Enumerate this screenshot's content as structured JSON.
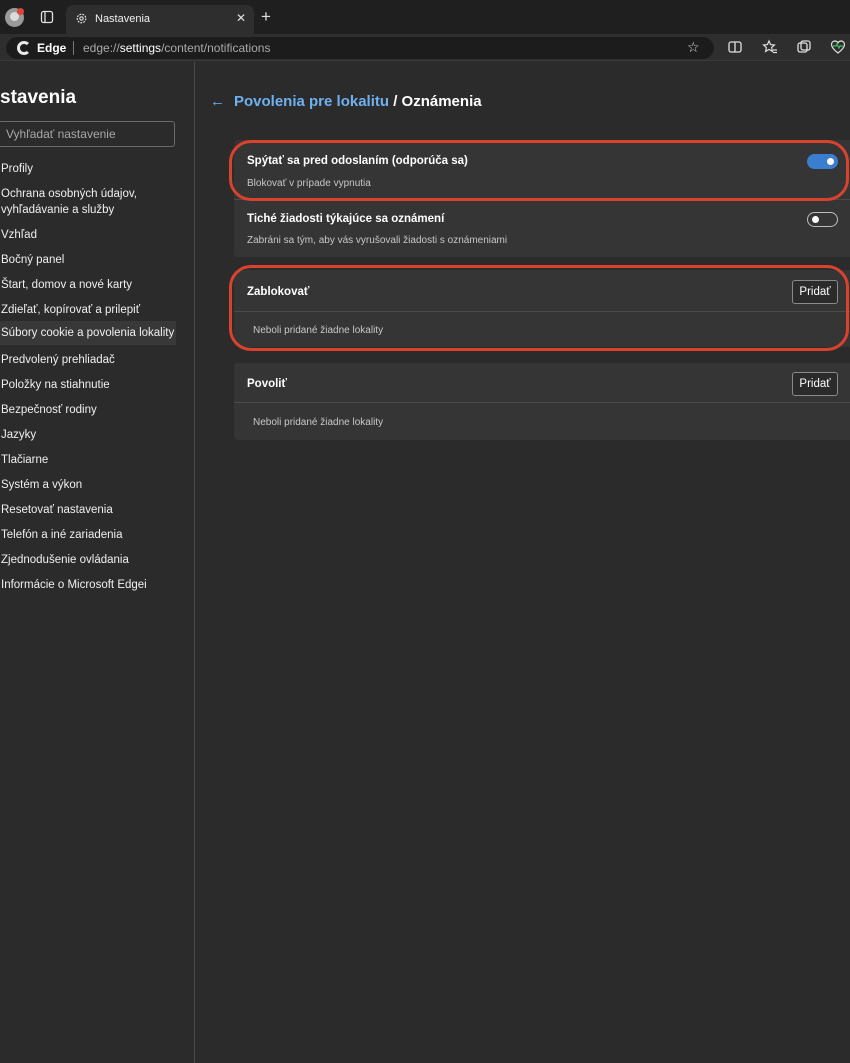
{
  "browser": {
    "tab_title": "Nastavenia",
    "tab_close": "✕",
    "new_tab": "+",
    "brand": "Edge",
    "url_prefix": "edge://",
    "url_bold": "settings",
    "url_rest": "/content/notifications",
    "favorite_star": "☆"
  },
  "sidebar": {
    "title": "stavenia",
    "search_placeholder": "Vyhľadať nastavenie",
    "items": [
      "Profily",
      "Ochrana osobných údajov, vyhľadávanie a služby",
      "Vzhľad",
      "Bočný panel",
      "Štart, domov a nové karty",
      "Zdieľať, kopírovať a prilepiť",
      "Súbory cookie a povolenia lokality",
      "Predvolený prehliadač",
      "Položky na stiahnutie",
      "Bezpečnosť rodiny",
      "Jazyky",
      "Tlačiarne",
      "Systém a výkon",
      "Resetovať nastavenia",
      "Telefón a iné zariadenia",
      "Zjednodušenie ovládania",
      "Informácie o Microsoft Edgei"
    ]
  },
  "main": {
    "back_arrow": "←",
    "breadcrumb_link": "Povolenia pre lokalitu",
    "breadcrumb_current": " / Oznámenia",
    "ask_title": "Spýtať sa pred odoslaním (odporúča sa)",
    "ask_sub": "Blokovať v prípade vypnutia",
    "ask_on": true,
    "quiet_title": "Tiché žiadosti týkajúce sa oznámení",
    "quiet_sub": "Zabráni sa tým, aby vás vyrušovali žiadosti s oznámeniami",
    "quiet_on": false,
    "block_title": "Zablokovať",
    "block_add": "Pridať",
    "block_empty": "Neboli pridané žiadne lokality",
    "allow_title": "Povoliť",
    "allow_add": "Pridať",
    "allow_empty": "Neboli pridané žiadne lokality"
  },
  "colors": {
    "highlight": "#d9432e",
    "accent": "#3a7fcf",
    "link": "#6fb1f0"
  }
}
